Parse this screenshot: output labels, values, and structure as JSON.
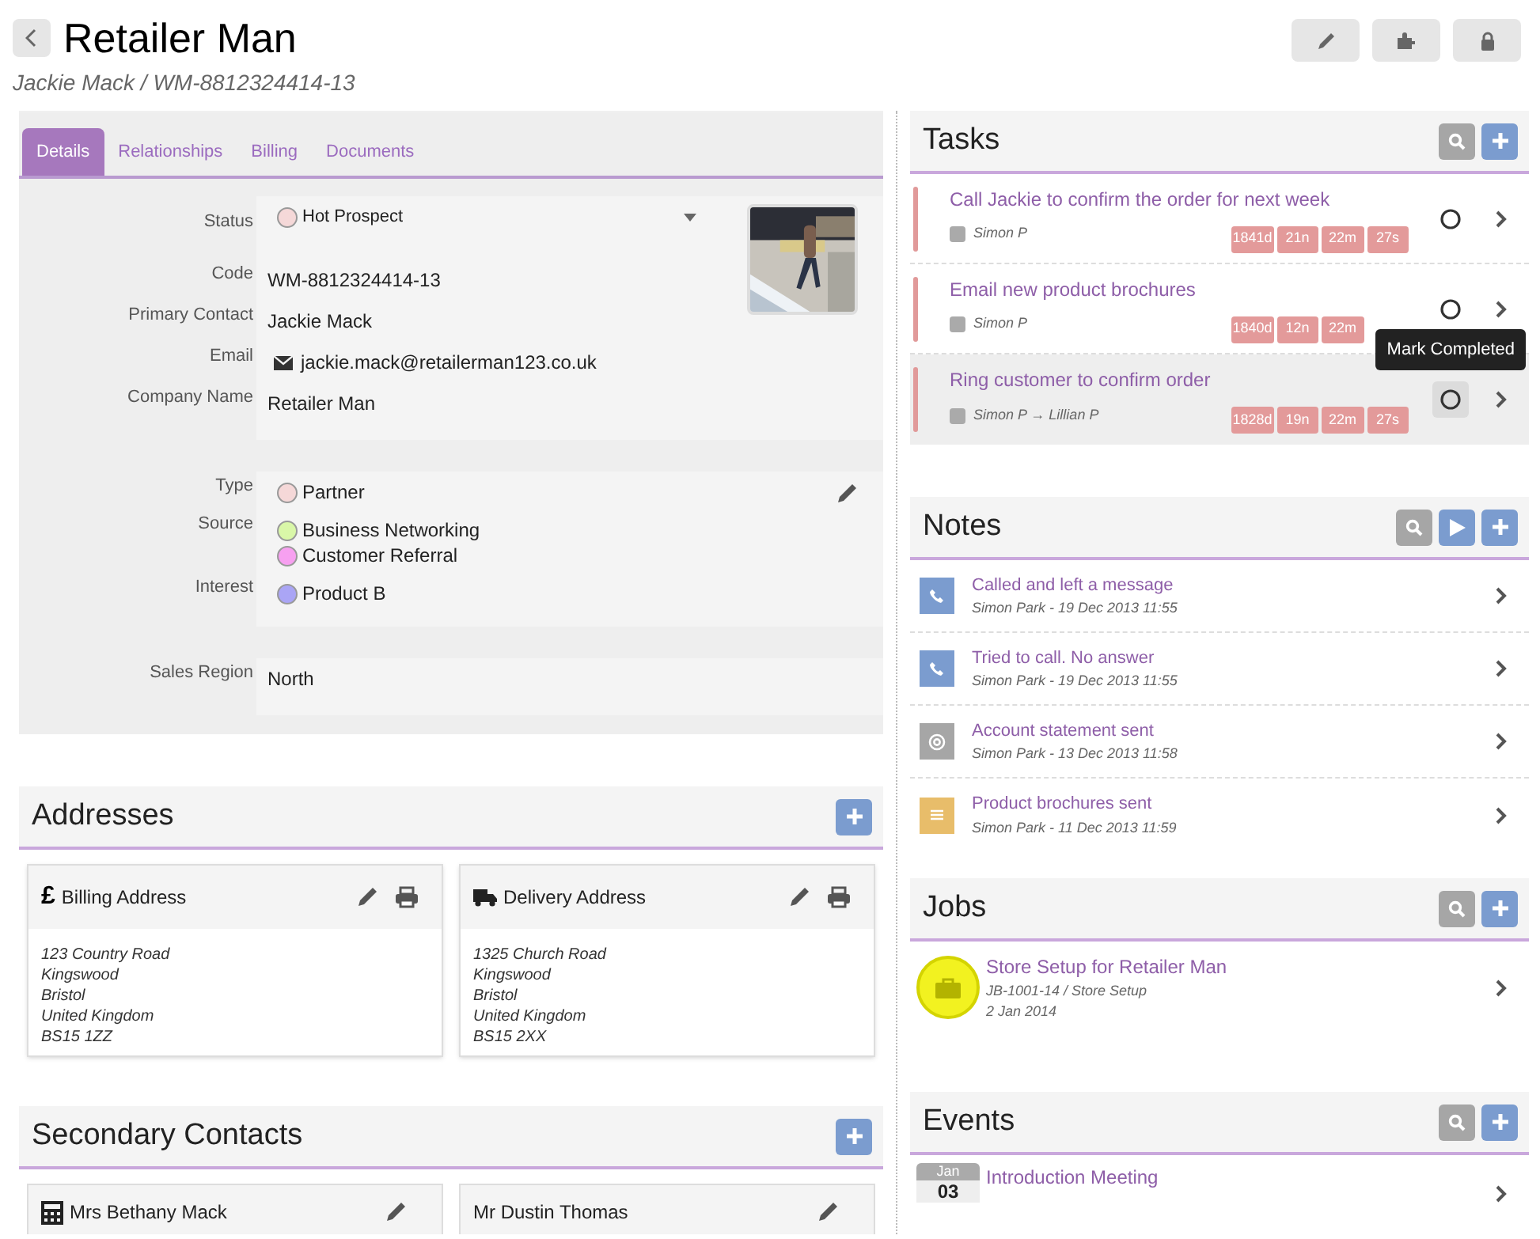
{
  "header": {
    "title": "Retailer Man",
    "subtitle": "Jackie Mack / WM-8812324414-13"
  },
  "details": {
    "tabs": [
      {
        "label": "Details",
        "selected": true
      },
      {
        "label": "Relationships",
        "selected": false
      },
      {
        "label": "Billing",
        "selected": false
      },
      {
        "label": "Documents",
        "selected": false
      }
    ],
    "groups": [
      [
        {
          "label": "Status",
          "kind": "select",
          "values": [
            {
              "text": "Hot Prospect",
              "color": "#f5d8d8"
            }
          ]
        },
        {
          "label": "Code",
          "kind": "text",
          "values": [
            {
              "text": "WM-8812324414-13"
            }
          ]
        },
        {
          "label": "Primary Contact",
          "kind": "text",
          "values": [
            {
              "text": "Jackie Mack"
            }
          ]
        },
        {
          "label": "Email",
          "kind": "email",
          "values": [
            {
              "text": "jackie.mack@retailerman123.co.uk"
            }
          ]
        },
        {
          "label": "Company Name",
          "kind": "text",
          "values": [
            {
              "text": "Retailer Man"
            }
          ]
        }
      ],
      [
        {
          "label": "Type",
          "kind": "tags",
          "values": [
            {
              "text": "Partner",
              "color": "#f5d8d8"
            }
          ]
        },
        {
          "label": "Source",
          "kind": "tags",
          "values": [
            {
              "text": "Business Networking",
              "color": "#d9f7a8"
            },
            {
              "text": "Customer Referral",
              "color": "#f7a0f0"
            }
          ]
        },
        {
          "label": "Interest",
          "kind": "tags",
          "values": [
            {
              "text": "Product B",
              "color": "#aaa5f5"
            }
          ]
        }
      ],
      [
        {
          "label": "Sales Region",
          "kind": "text",
          "values": [
            {
              "text": "North"
            }
          ]
        }
      ]
    ]
  },
  "addresses": {
    "title": "Addresses",
    "cards": [
      {
        "kind": "billing",
        "symbol": "£",
        "title": "Billing Address",
        "lines": [
          "123 Country Road",
          "Kingswood",
          "Bristol",
          "United Kingdom",
          "BS15 1ZZ"
        ]
      },
      {
        "kind": "delivery",
        "title": "Delivery Address",
        "lines": [
          "1325 Church Road",
          "Kingswood",
          "Bristol",
          "United Kingdom",
          "BS15 2XX"
        ]
      }
    ]
  },
  "secondary_contacts": {
    "title": "Secondary Contacts",
    "cards": [
      {
        "has_icon": true,
        "name": "Mrs Bethany Mack"
      },
      {
        "has_icon": false,
        "name": "Mr Dustin Thomas"
      }
    ]
  },
  "tasks": {
    "title": "Tasks",
    "items": [
      {
        "title": "Call Jackie to confirm the order for next week",
        "people": "Simon P",
        "timers": [
          "1841d",
          "21n",
          "22m",
          "27s"
        ],
        "hovered": false
      },
      {
        "title": "Email new product brochures",
        "people": "Simon P",
        "timers": [
          "1840d",
          "12n",
          "22m"
        ],
        "hovered": false
      },
      {
        "title": "Ring customer to confirm order",
        "people": "Simon P → Lillian P",
        "timers": [
          "1828d",
          "19n",
          "22m",
          "27s"
        ],
        "hovered": true,
        "tooltip": "Mark Completed"
      }
    ]
  },
  "notes": {
    "title": "Notes",
    "items": [
      {
        "kind": "call",
        "title": "Called and left a message",
        "meta": "Simon Park - 19 Dec 2013 11:55"
      },
      {
        "kind": "call",
        "title": "Tried to call. No answer",
        "meta": "Simon Park - 19 Dec 2013 11:55"
      },
      {
        "kind": "email",
        "title": "Account statement sent",
        "meta": "Simon Park - 13 Dec 2013 11:58"
      },
      {
        "kind": "note",
        "title": "Product brochures sent",
        "meta": "Simon Park - 11 Dec 2013 11:59"
      }
    ]
  },
  "jobs": {
    "title": "Jobs",
    "items": [
      {
        "title": "Store Setup for Retailer Man",
        "ref": "JB-1001-14 / Store Setup",
        "date": "2 Jan 2014"
      }
    ]
  },
  "events": {
    "title": "Events",
    "items": [
      {
        "month": "Jan",
        "day": "03",
        "title": "Introduction Meeting"
      }
    ]
  }
}
